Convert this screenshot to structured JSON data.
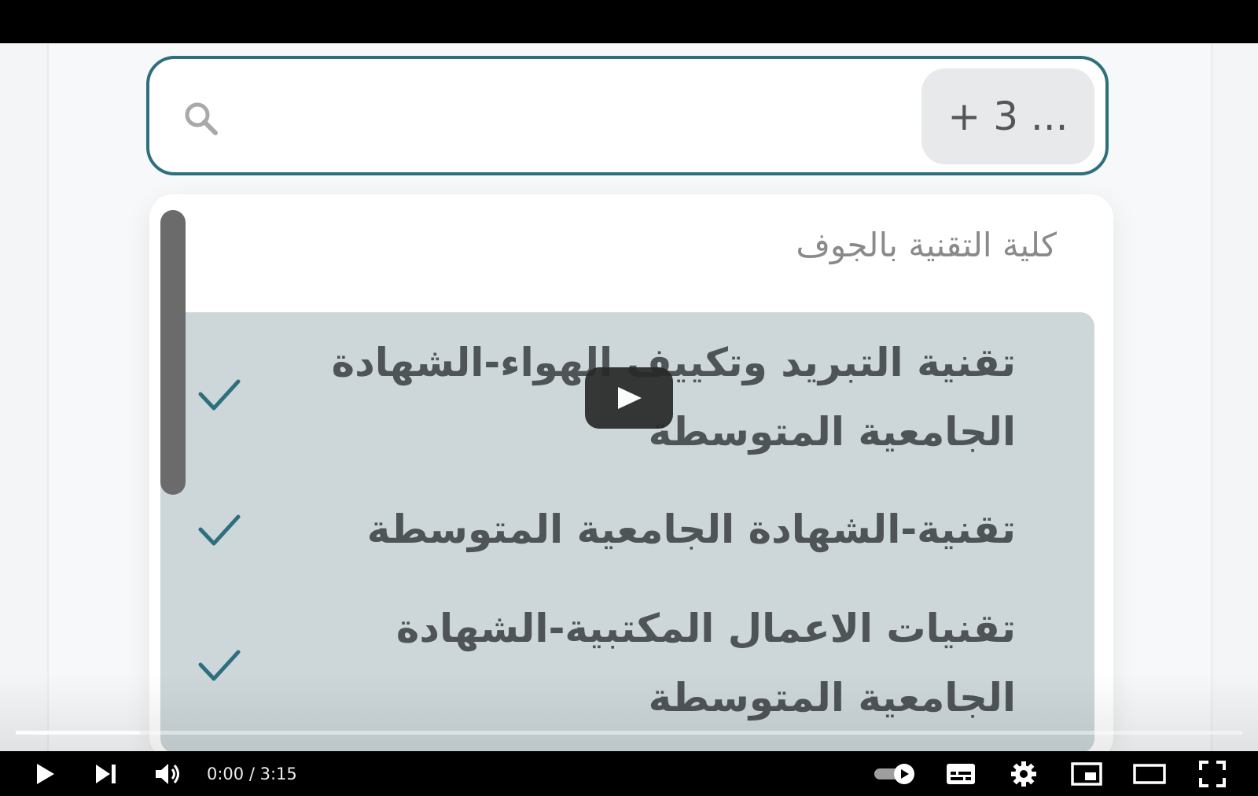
{
  "search": {
    "selected_chip": "+ 3 ..."
  },
  "dropdown": {
    "group_label": "كلية التقنية بالجوف",
    "options": [
      {
        "label": "تقنية التبريد وتكييف الهواء-الشهادة الجامعية المتوسطة",
        "selected": true
      },
      {
        "label": "تقنية-الشهادة الجامعية المتوسطة",
        "selected": true
      },
      {
        "label": "تقنيات الاعمال المكتبية-الشهادة الجامعية المتوسطة",
        "selected": true
      }
    ]
  },
  "player": {
    "current_time": "0:00",
    "duration": "3:15",
    "time_display": "0:00 / 3:15",
    "progress": 0.0,
    "autoplay_on": true,
    "icons": [
      "play-icon",
      "next-icon",
      "volume-icon",
      "autoplay-toggle-icon",
      "subtitles-icon",
      "settings-icon",
      "miniplayer-icon",
      "theater-mode-icon",
      "fullscreen-icon"
    ]
  },
  "colors": {
    "accent": "#2e6f7e",
    "selected_option_bg": "#cdd7da",
    "check": "#2e6f7e",
    "progress": "#ff0000"
  }
}
